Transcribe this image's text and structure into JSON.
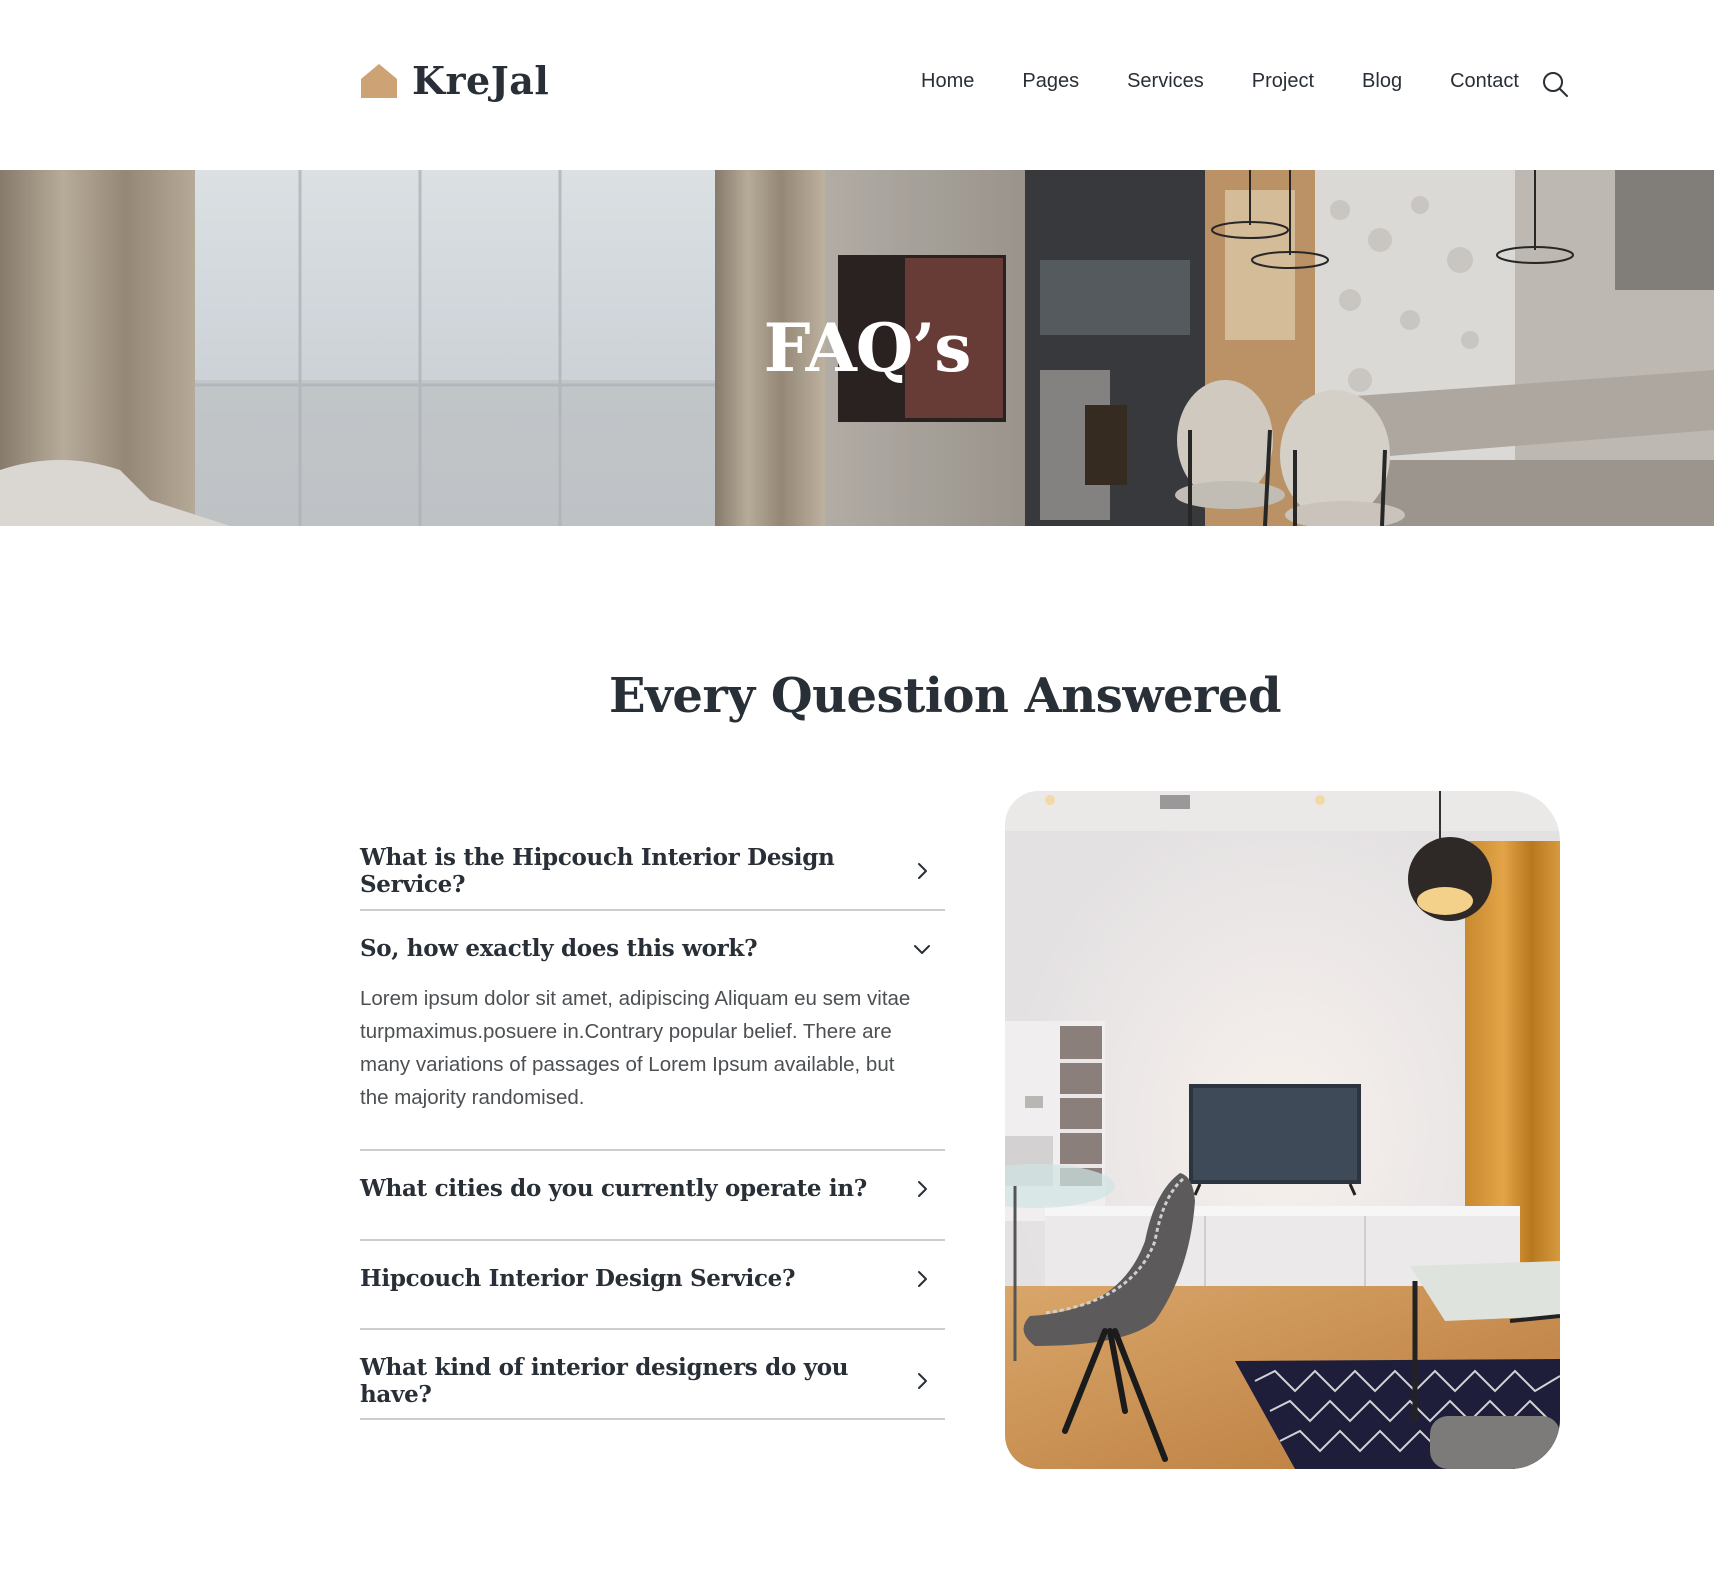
{
  "brand": {
    "name": "KreJal",
    "accent": "#CDA274",
    "dark": "#292F36"
  },
  "nav": {
    "items": [
      "Home",
      "Pages",
      "Services",
      "Project",
      "Blog",
      "Contact"
    ],
    "search_icon": "search-icon"
  },
  "hero": {
    "title": "FAQ’s"
  },
  "faq": {
    "title": "Every Question Answered",
    "items": [
      {
        "question": "What is the Hipcouch Interior Design Service?",
        "expanded": false
      },
      {
        "question": "So, how exactly does this work?",
        "expanded": true,
        "answer": "Lorem ipsum dolor sit amet, adipiscing Aliquam eu sem vitae turpmaximus.posuere in.Contrary popular belief. There are many variations of passages of Lorem Ipsum available, but the majority randomised."
      },
      {
        "question": "What cities do you currently operate in?",
        "expanded": false
      },
      {
        "question": "Hipcouch Interior Design Service?",
        "expanded": false
      },
      {
        "question": "What kind of interior designers do you have?",
        "expanded": false
      }
    ]
  }
}
